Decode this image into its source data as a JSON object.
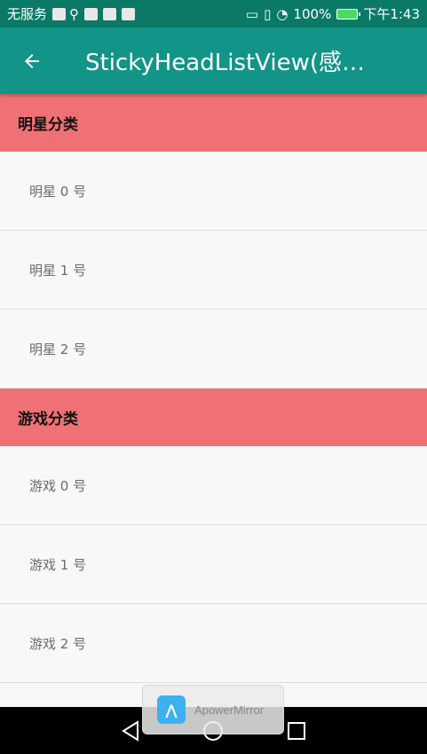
{
  "status_bar": {
    "carrier": "无服务",
    "battery": "100%",
    "time": "下午1:43"
  },
  "app_bar": {
    "back_icon": "arrow-left-icon",
    "title": "StickyHeadListView(感谢大…"
  },
  "sections": [
    {
      "header": "明星分类",
      "items": [
        "明星 0 号",
        "明星 1 号",
        "明星 2 号"
      ]
    },
    {
      "header": "游戏分类",
      "items": [
        "游戏 0 号",
        "游戏 1 号",
        "游戏 2 号"
      ]
    }
  ],
  "toast": {
    "label": "ApowerMirror"
  },
  "colors": {
    "status_bar": "#0a7a66",
    "app_bar": "#139488",
    "section_header": "#f07175",
    "list_bg": "#f8f8f8"
  }
}
